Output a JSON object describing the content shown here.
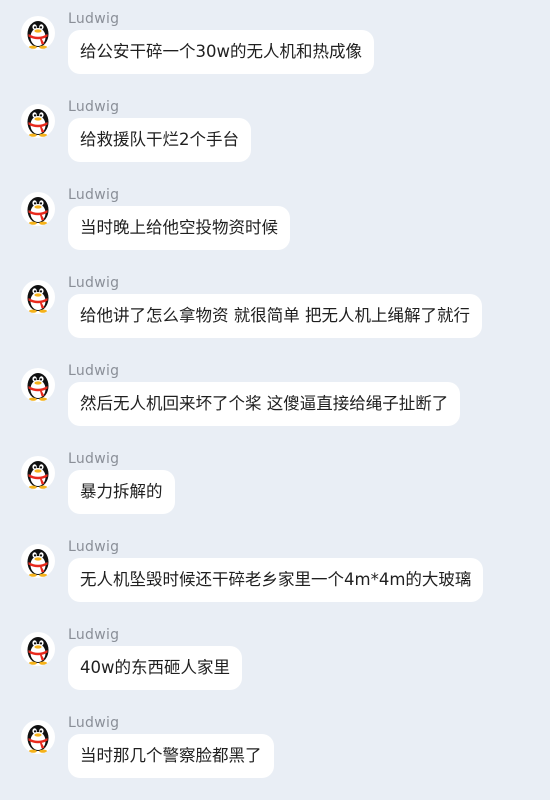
{
  "chat": {
    "messages": [
      {
        "sender": "Ludwig",
        "text": "给公安干碎一个30w的无人机和热成像"
      },
      {
        "sender": "Ludwig",
        "text": "给救援队干烂2个手台"
      },
      {
        "sender": "Ludwig",
        "text": "当时晚上给他空投物资时候"
      },
      {
        "sender": "Ludwig",
        "text": "给他讲了怎么拿物资 就很简单 把无人机上绳解了就行"
      },
      {
        "sender": "Ludwig",
        "text": "然后无人机回来坏了个桨 这傻逼直接给绳子扯断了"
      },
      {
        "sender": "Ludwig",
        "text": "暴力拆解的"
      },
      {
        "sender": "Ludwig",
        "text": "无人机坠毁时候还干碎老乡家里一个4m*4m的大玻璃"
      },
      {
        "sender": "Ludwig",
        "text": "40w的东西砸人家里"
      },
      {
        "sender": "Ludwig",
        "text": "当时那几个警察脸都黑了"
      }
    ],
    "avatar_icon": "qq-penguin-icon"
  },
  "colors": {
    "background": "#e9eef5",
    "bubble": "#ffffff",
    "sender_name": "#8a8f98",
    "text": "#1f1f1f",
    "scarf": "#e8291c",
    "beak": "#f5b21a"
  }
}
